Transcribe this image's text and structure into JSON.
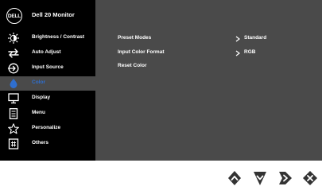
{
  "header": {
    "logo_text": "DELL",
    "model": "Dell 20 Monitor"
  },
  "sidebar": {
    "items": [
      {
        "label": "Brightness / Contrast",
        "icon": "brightness-icon"
      },
      {
        "label": "Auto Adjust",
        "icon": "auto-adjust-icon"
      },
      {
        "label": "Input Source",
        "icon": "input-source-icon"
      },
      {
        "label": "Color",
        "icon": "color-drop-icon",
        "active": true
      },
      {
        "label": "Display",
        "icon": "display-icon"
      },
      {
        "label": "Menu",
        "icon": "menu-icon"
      },
      {
        "label": "Personalize",
        "icon": "star-icon"
      },
      {
        "label": "Others",
        "icon": "others-icon"
      }
    ]
  },
  "main": {
    "options": [
      {
        "label": "Preset Modes",
        "value": "Standard"
      },
      {
        "label": "Input Color Format",
        "value": "RGB"
      },
      {
        "label": "Reset Color"
      }
    ]
  },
  "buttons": [
    {
      "icon": "up-arrow-button-icon"
    },
    {
      "icon": "down-arrow-button-icon"
    },
    {
      "icon": "right-arrow-button-icon"
    },
    {
      "icon": "close-button-icon"
    }
  ],
  "colors": {
    "active_accent": "#2f6fcf",
    "sidebar_bg": "#000000",
    "panel_bg": "#4a4a4a"
  }
}
